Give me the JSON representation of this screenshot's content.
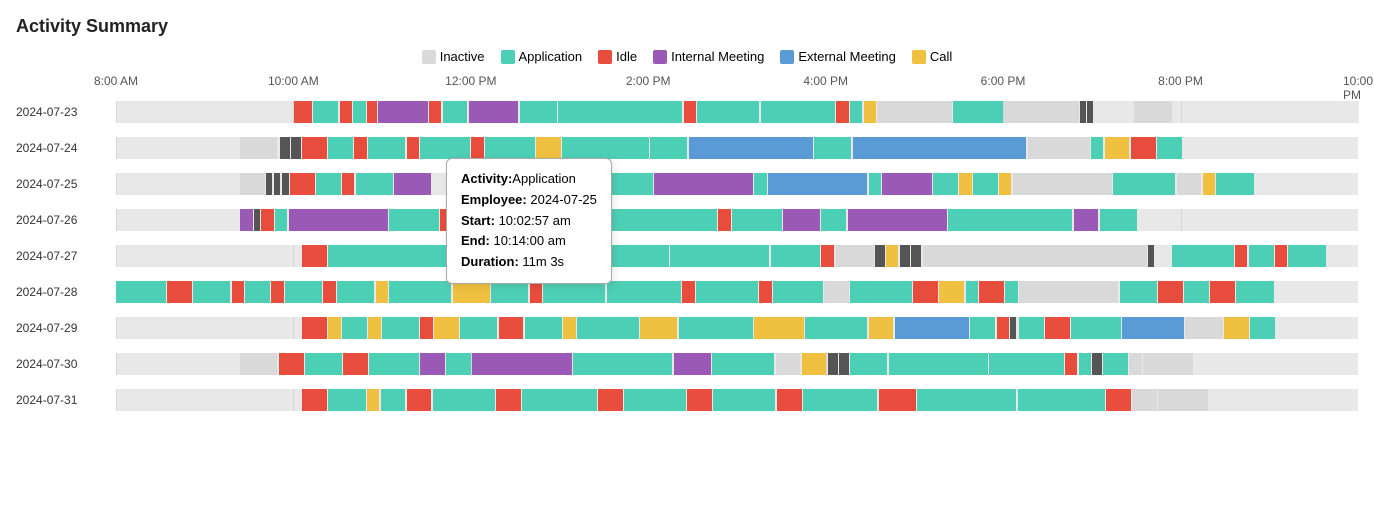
{
  "title": "Activity Summary",
  "legend": [
    {
      "label": "Inactive",
      "color": "#d9d9d9"
    },
    {
      "label": "Application",
      "color": "#4dcfb5"
    },
    {
      "label": "Idle",
      "color": "#e74c3c"
    },
    {
      "label": "Internal Meeting",
      "color": "#9b59b6"
    },
    {
      "label": "External Meeting",
      "color": "#5b9bd5"
    },
    {
      "label": "Call",
      "color": "#f0c040"
    }
  ],
  "time_labels": [
    {
      "label": "8:00 AM",
      "pct": 0
    },
    {
      "label": "10:00 AM",
      "pct": 14.28
    },
    {
      "label": "12:00 PM",
      "pct": 28.57
    },
    {
      "label": "2:00 PM",
      "pct": 42.85
    },
    {
      "label": "4:00 PM",
      "pct": 57.14
    },
    {
      "label": "6:00 PM",
      "pct": 71.42
    },
    {
      "label": "8:00 PM",
      "pct": 85.71
    },
    {
      "label": "10:00 PM",
      "pct": 100
    }
  ],
  "tooltip": {
    "activity_label": "Activity:",
    "activity_value": "Application",
    "employee_label": "Employee:",
    "employee_value": "2024-07-25",
    "start_label": "Start:",
    "start_value": "10:02:57 am",
    "end_label": "End:",
    "end_value": "10:14:00 am",
    "duration_label": "Duration:",
    "duration_value": "11m 3s"
  },
  "rows": [
    {
      "date": "2024-07-23"
    },
    {
      "date": "2024-07-24"
    },
    {
      "date": "2024-07-25"
    },
    {
      "date": "2024-07-26"
    },
    {
      "date": "2024-07-27"
    },
    {
      "date": "2024-07-28"
    },
    {
      "date": "2024-07-29"
    },
    {
      "date": "2024-07-30"
    },
    {
      "date": "2024-07-31"
    }
  ]
}
